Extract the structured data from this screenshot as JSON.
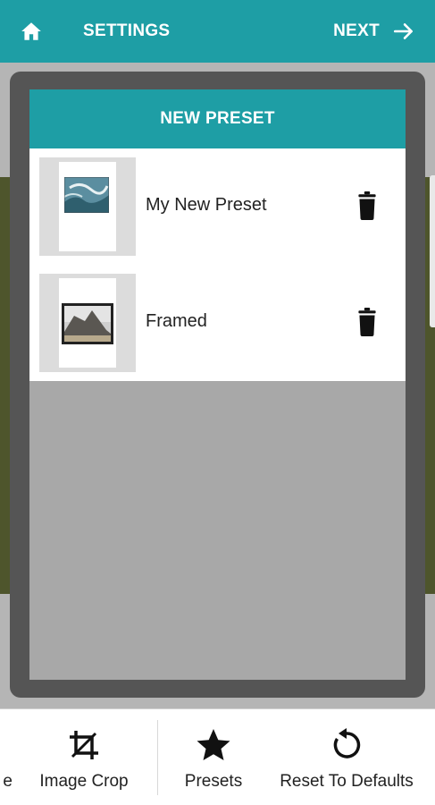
{
  "topbar": {
    "home_icon": "home-icon",
    "settings_label": "SETTINGS",
    "next_label": "NEXT",
    "next_icon": "arrow-right-icon",
    "color": "#1e9ea5"
  },
  "dialog": {
    "title": "NEW PRESET",
    "presets": [
      {
        "name": "My New Preset",
        "delete_icon": "trash-icon"
      },
      {
        "name": "Framed",
        "delete_icon": "trash-icon"
      }
    ]
  },
  "toolbar": {
    "items": [
      {
        "label": "e",
        "icon": ""
      },
      {
        "label": "Image Crop",
        "icon": "crop-icon"
      },
      {
        "label": "Presets",
        "icon": "star-icon"
      },
      {
        "label": "Reset To Defaults",
        "icon": "reset-icon"
      }
    ]
  }
}
